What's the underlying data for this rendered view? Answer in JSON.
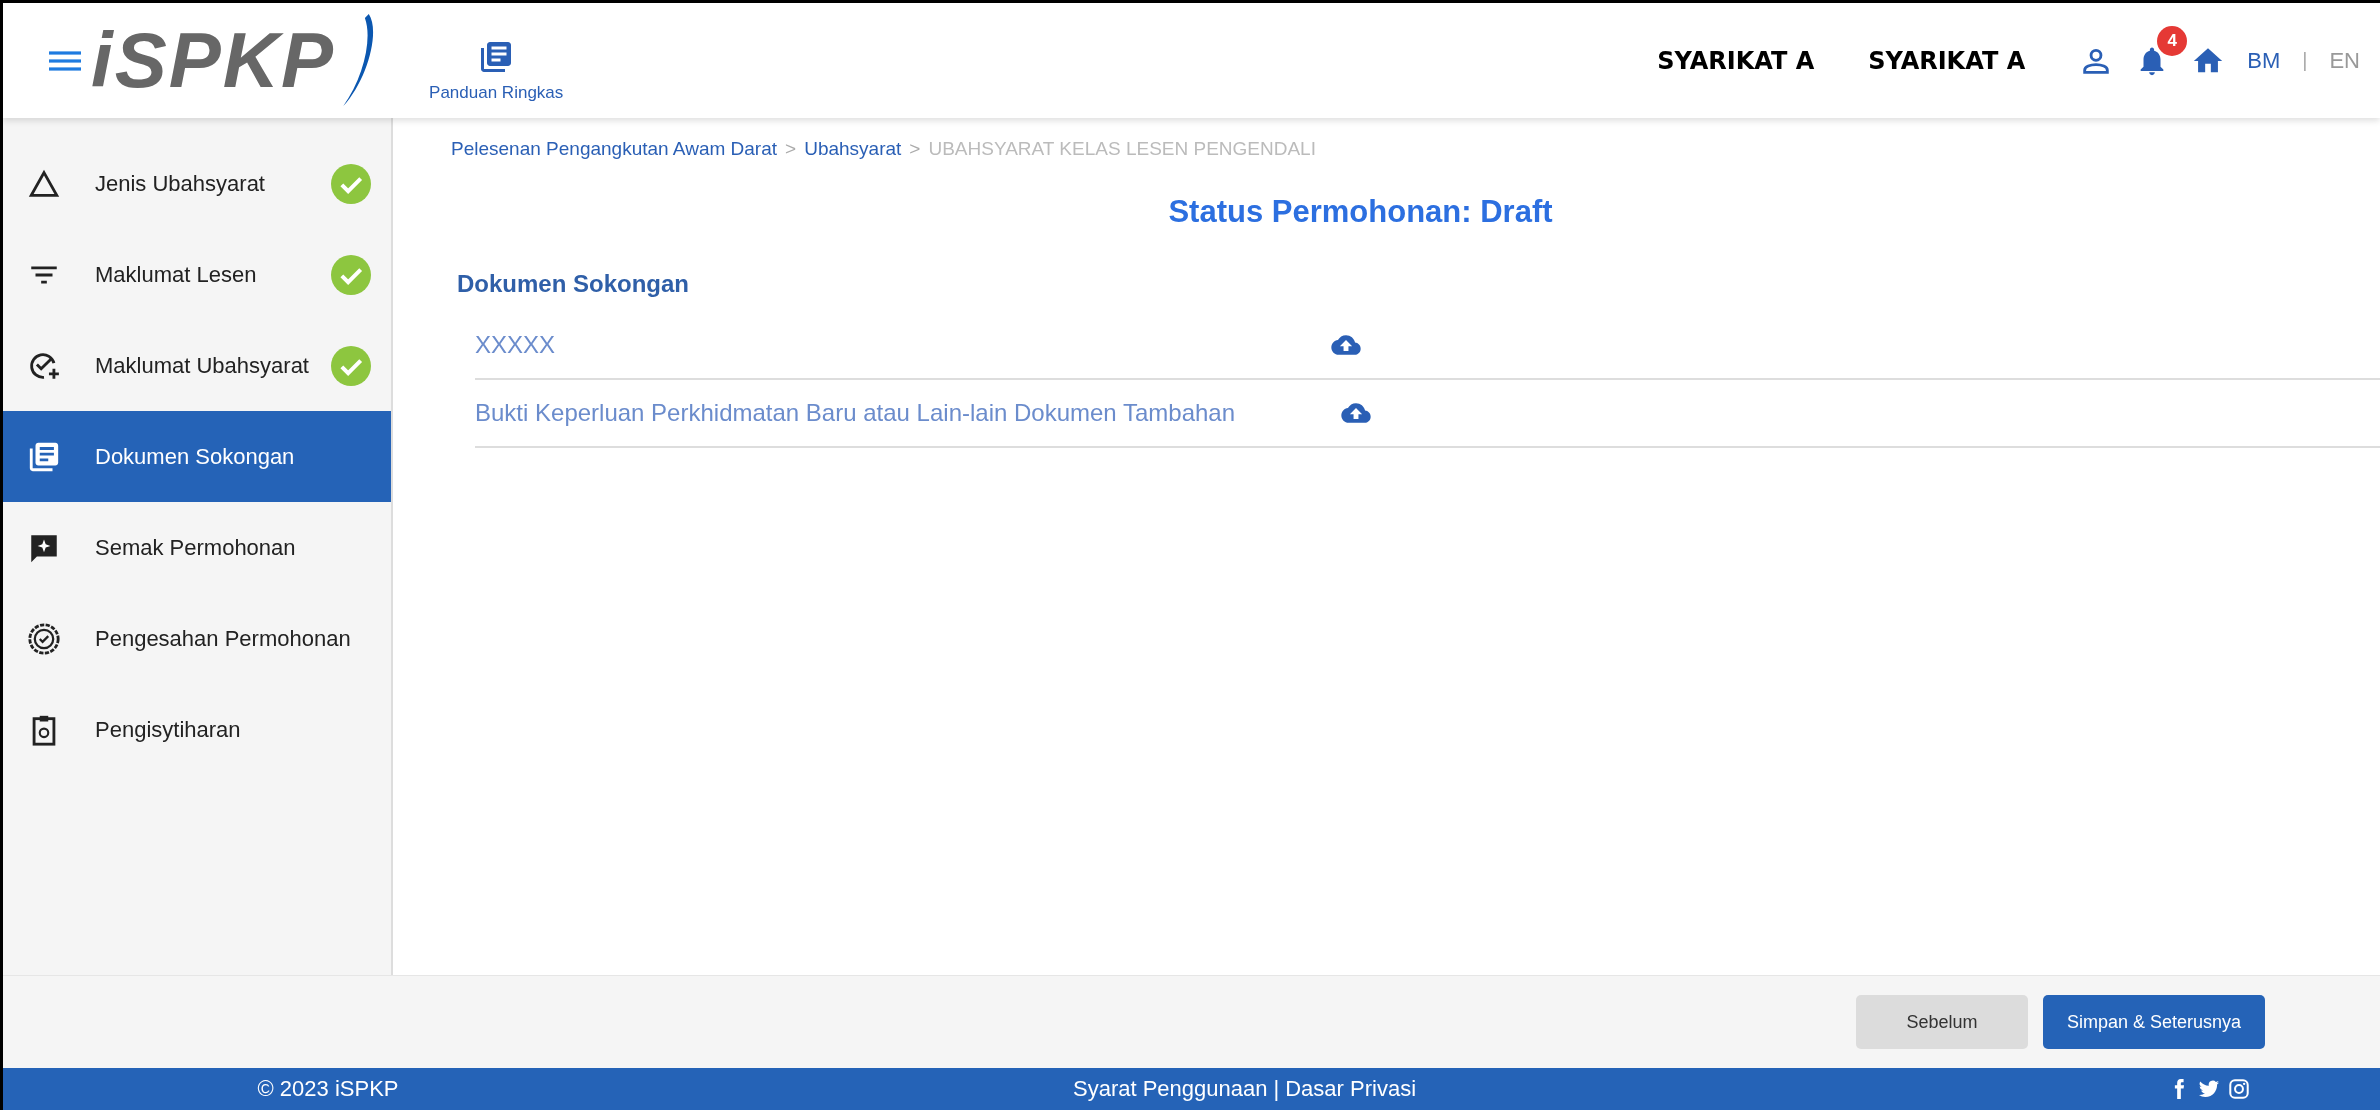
{
  "header": {
    "logo": "iSPKP",
    "guide": {
      "label": "Panduan Ringkas"
    },
    "company_names": [
      "SYARIKAT A",
      "SYARIKAT A"
    ],
    "notification_count": "4",
    "languages": [
      {
        "label": "BM",
        "selected": true
      },
      {
        "label": "EN",
        "selected": false
      }
    ],
    "language_separator": "|"
  },
  "sidebar": {
    "items": [
      {
        "label": "Jenis Ubahsyarat",
        "completed": true,
        "selected": false
      },
      {
        "label": "Maklumat Lesen",
        "completed": true,
        "selected": false
      },
      {
        "label": "Maklumat Ubahsyarat",
        "completed": true,
        "selected": false
      },
      {
        "label": "Dokumen Sokongan",
        "completed": false,
        "selected": true
      },
      {
        "label": "Semak Permohonan",
        "completed": false,
        "selected": false
      },
      {
        "label": "Pengesahan Permohonan",
        "completed": false,
        "selected": false
      },
      {
        "label": "Pengisytiharan",
        "completed": false,
        "selected": false
      }
    ]
  },
  "breadcrumb_separator": ">",
  "breadcrumb": [
    {
      "label": "Pelesenan Pengangkutan Awam Darat",
      "current": false
    },
    {
      "label": "Ubahsyarat",
      "current": false
    },
    {
      "label": "UBAHSYARAT KELAS LESEN PENGENDALI",
      "current": true
    }
  ],
  "status_title": "Status Permohonan: Draft",
  "section_title": "Dokumen Sokongan",
  "documents": [
    {
      "name": "XXXXX"
    },
    {
      "name": "Bukti Keperluan Perkhidmatan Baru atau Lain-lain Dokumen Tambahan"
    }
  ],
  "buttons": {
    "previous": "Sebelum",
    "next": "Simpan & Seterusnya"
  },
  "footer": {
    "copyright": "© 2023 iSPKP",
    "links": [
      "Syarat Penggunaan",
      "Dasar Privasi"
    ],
    "separator": "|"
  }
}
